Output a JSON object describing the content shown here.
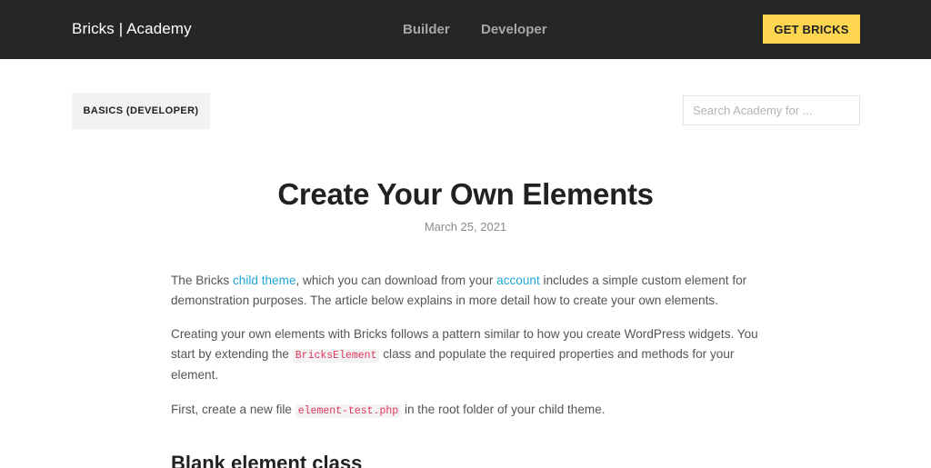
{
  "header": {
    "logo": "Bricks | Academy",
    "nav": [
      "Builder",
      "Developer"
    ],
    "cta": "GET BRICKS"
  },
  "category_badge": "BASICS (DEVELOPER)",
  "search": {
    "placeholder": "Search Academy for ..."
  },
  "article": {
    "title": "Create Your Own Elements",
    "date": "March 25, 2021",
    "p1": {
      "t1": "The Bricks ",
      "link1": "child theme",
      "t2": ", which you can download from your ",
      "link2": "account",
      "t3": " includes a simple custom element for demonstration purposes. The article below explains in more detail how to create your own elements."
    },
    "p2": {
      "t1": "Creating your own elements with Bricks follows a pattern similar to how you create WordPress widgets. You start by extending the ",
      "code": "BricksElement",
      "t2": " class and populate the required properties and methods for your element."
    },
    "p3": {
      "t1": "First, create a new file ",
      "code": "element-test.php",
      "t2": " in the root folder of your child theme."
    },
    "section_heading": "Blank element class"
  },
  "colors": {
    "header_bg": "#262626",
    "cta_bg": "#ffd64f",
    "link": "#1ea7d6",
    "code_text": "#e3365b"
  }
}
